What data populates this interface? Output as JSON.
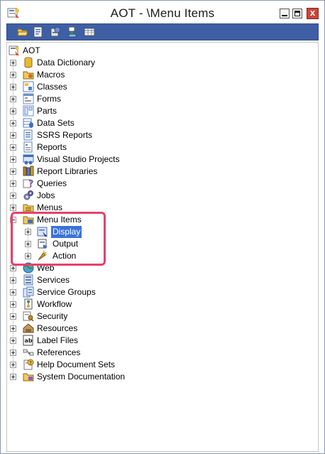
{
  "window": {
    "title": "AOT - \\Menu Items",
    "icon": "aot-window-icon",
    "controls": [
      "minimize-button",
      "maximize-button",
      "close-button"
    ]
  },
  "toolbar": {
    "buttons": [
      {
        "name": "open-icon"
      },
      {
        "name": "properties-icon"
      },
      {
        "name": "compile-icon"
      },
      {
        "name": "import-icon"
      },
      {
        "name": "grid-icon"
      }
    ]
  },
  "tree": {
    "root": {
      "label": "AOT",
      "icon": "aot-root-icon"
    },
    "nodes": [
      {
        "label": "Data Dictionary",
        "icon": "database-icon",
        "color": "#e8b832"
      },
      {
        "label": "Macros",
        "icon": "macros-icon",
        "color": "#d4a032"
      },
      {
        "label": "Classes",
        "icon": "classes-icon",
        "color": "#5a7fc2"
      },
      {
        "label": "Forms",
        "icon": "forms-icon",
        "color": "#6f8fc8"
      },
      {
        "label": "Parts",
        "icon": "parts-icon",
        "color": "#6f8fc8"
      },
      {
        "label": "Data Sets",
        "icon": "datasets-icon",
        "color": "#5a7fc2"
      },
      {
        "label": "SSRS Reports",
        "icon": "ssrs-reports-icon",
        "color": "#5a7fc2"
      },
      {
        "label": "Reports",
        "icon": "reports-icon",
        "color": "#5a7fc2"
      },
      {
        "label": "Visual Studio Projects",
        "icon": "vs-projects-icon",
        "color": "#3d6fc4"
      },
      {
        "label": "Report Libraries",
        "icon": "report-libraries-icon",
        "color": "#b77f2e"
      },
      {
        "label": "Queries",
        "icon": "queries-icon",
        "color": "#8a5bbf"
      },
      {
        "label": "Jobs",
        "icon": "jobs-icon",
        "color": "#6a6fa8"
      },
      {
        "label": "Menus",
        "icon": "menus-icon",
        "color": "#d4a032"
      },
      {
        "label": "Menu Items",
        "icon": "menu-items-icon",
        "color": "#d4a032",
        "expanded": true,
        "children": [
          {
            "label": "Display",
            "icon": "display-icon",
            "selected": true,
            "color": "#3d6fc4"
          },
          {
            "label": "Output",
            "icon": "output-icon",
            "color": "#3d6fc4"
          },
          {
            "label": "Action",
            "icon": "action-icon",
            "color": "#d49a2a"
          }
        ]
      },
      {
        "label": "Web",
        "icon": "globe-icon",
        "color": "#2f7fb0"
      },
      {
        "label": "Services",
        "icon": "services-icon",
        "color": "#5a7fc2"
      },
      {
        "label": "Service Groups",
        "icon": "service-groups-icon",
        "color": "#5a7fc2"
      },
      {
        "label": "Workflow",
        "icon": "workflow-icon",
        "color": "#4e8a3a"
      },
      {
        "label": "Security",
        "icon": "security-icon",
        "color": "#c28a2e"
      },
      {
        "label": "Resources",
        "icon": "resources-icon",
        "color": "#8a6a3a"
      },
      {
        "label": "Label Files",
        "icon": "label-files-icon",
        "color": "#444444"
      },
      {
        "label": "References",
        "icon": "references-icon",
        "color": "#7a7a7a"
      },
      {
        "label": "Help Document Sets",
        "icon": "help-docs-icon",
        "color": "#d4a032"
      },
      {
        "label": "System Documentation",
        "icon": "system-docs-icon",
        "color": "#d4a032"
      }
    ]
  },
  "colors": {
    "toolbar": "#3f5fa5",
    "selection": "#3a73d8",
    "highlight": "#e8416b",
    "close_button": "#c9473a"
  }
}
